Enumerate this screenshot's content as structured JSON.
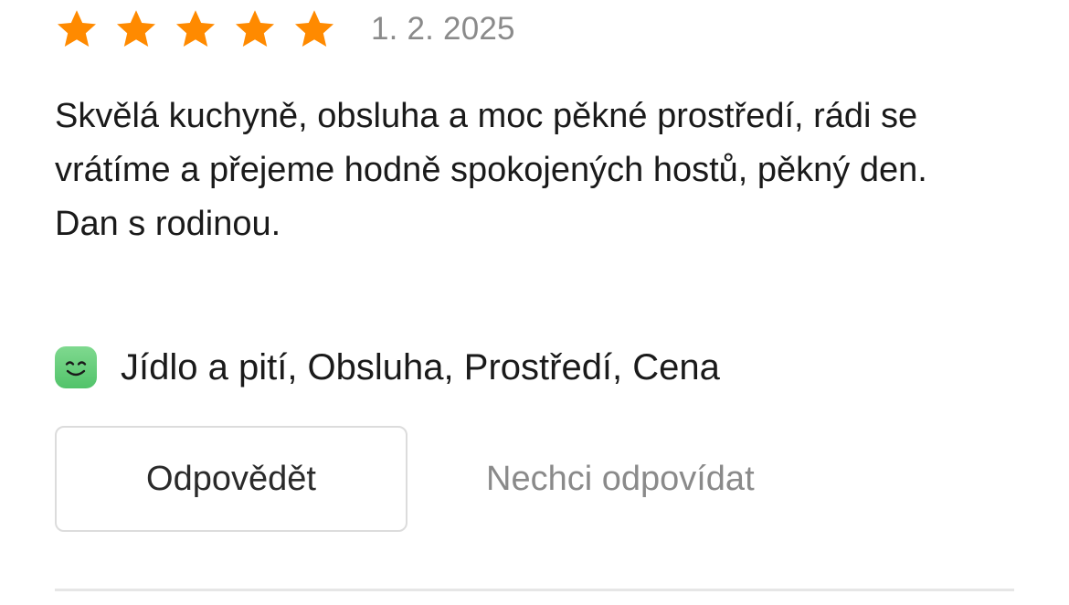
{
  "review": {
    "rating": 5,
    "rating_max": 5,
    "star_color": "#ff8a00",
    "date": "1. 2. 2025",
    "text_lines": [
      "Skvělá kuchyně, obsluha a moc pěkné prostředí, rádi se vrátíme a přejeme hodně spokojených hostů, pěkný den.",
      "Dan s rodinou."
    ],
    "sentiment_icon": "smiley-face-icon",
    "sentiment_color": "#5ccb71",
    "tags": "Jídlo a pití, Obsluha, Prostředí, Cena"
  },
  "actions": {
    "reply_label": "Odpovědět",
    "decline_label": "Nechci odpovídat"
  }
}
